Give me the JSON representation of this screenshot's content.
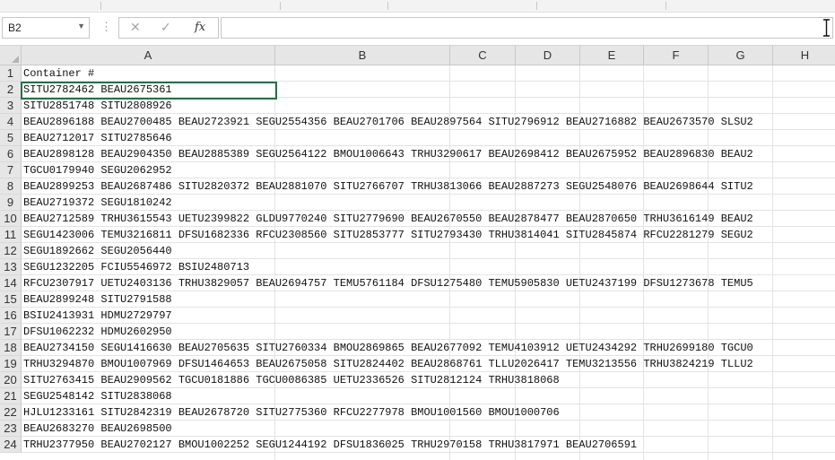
{
  "formula_bar": {
    "name_box": "B2",
    "formula": "",
    "cancel_icon": "cancel-icon",
    "enter_icon": "check-icon",
    "function_label": "fx"
  },
  "columns": [
    "A",
    "B",
    "C",
    "D",
    "E",
    "F",
    "G",
    "H"
  ],
  "rows": [
    {
      "num": "1",
      "text": "Container #"
    },
    {
      "num": "2",
      "text": "SITU2782462 BEAU2675361"
    },
    {
      "num": "3",
      "text": "SITU2851748 SITU2808926"
    },
    {
      "num": "4",
      "text": "BEAU2896188 BEAU2700485 BEAU2723921 SEGU2554356 BEAU2701706 BEAU2897564 SITU2796912 BEAU2716882 BEAU2673570 SLSU2"
    },
    {
      "num": "5",
      "text": "BEAU2712017 SITU2785646"
    },
    {
      "num": "6",
      "text": "BEAU2898128 BEAU2904350 BEAU2885389 SEGU2564122 BMOU1006643 TRHU3290617 BEAU2698412 BEAU2675952 BEAU2896830 BEAU2"
    },
    {
      "num": "7",
      "text": "TGCU0179940 SEGU2062952"
    },
    {
      "num": "8",
      "text": "BEAU2899253 BEAU2687486 SITU2820372 BEAU2881070 SITU2766707 TRHU3813066 BEAU2887273 SEGU2548076 BEAU2698644 SITU2"
    },
    {
      "num": "9",
      "text": "BEAU2719372 SEGU1810242"
    },
    {
      "num": "10",
      "text": "BEAU2712589 TRHU3615543 UETU2399822 GLDU9770240 SITU2779690 BEAU2670550 BEAU2878477 BEAU2870650 TRHU3616149 BEAU2"
    },
    {
      "num": "11",
      "text": "SEGU1423006 TEMU3216811 DFSU1682336 RFCU2308560 SITU2853777 SITU2793430 TRHU3814041 SITU2845874 RFCU2281279 SEGU2"
    },
    {
      "num": "12",
      "text": "SEGU1892662 SEGU2056440"
    },
    {
      "num": "13",
      "text": "SEGU1232205 FCIU5546972 BSIU2480713"
    },
    {
      "num": "14",
      "text": "RFCU2307917 UETU2403136 TRHU3829057 BEAU2694757 TEMU5761184 DFSU1275480 TEMU5905830 UETU2437199 DFSU1273678 TEMU5"
    },
    {
      "num": "15",
      "text": "BEAU2899248 SITU2791588"
    },
    {
      "num": "16",
      "text": "BSIU2413931 HDMU2729797"
    },
    {
      "num": "17",
      "text": "DFSU1062232 HDMU2602950"
    },
    {
      "num": "18",
      "text": "BEAU2734150 SEGU1416630 BEAU2705635 SITU2760334 BMOU2869865 BEAU2677092 TEMU4103912 UETU2434292 TRHU2699180 TGCU0"
    },
    {
      "num": "19",
      "text": "TRHU3294870 BMOU1007969 DFSU1464653 BEAU2675058 SITU2824402 BEAU2868761 TLLU2026417 TEMU3213556 TRHU3824219 TLLU2"
    },
    {
      "num": "20",
      "text": "SITU2763415 BEAU2909562 TGCU0181886 TGCU0086385 UETU2336526 SITU2812124 TRHU3818068"
    },
    {
      "num": "21",
      "text": "SEGU2548142 SITU2838068"
    },
    {
      "num": "22",
      "text": "HJLU1233161 SITU2842319 BEAU2678720 SITU2775360 RFCU2277978 BMOU1001560 BMOU1000706"
    },
    {
      "num": "23",
      "text": "BEAU2683270 BEAU2698500"
    },
    {
      "num": "24",
      "text": "TRHU2377950 BEAU2702127 BMOU1002252 SEGU1244192 DFSU1836025 TRHU2970158 TRHU3817971 BEAU2706591"
    }
  ],
  "colors": {
    "header_bg": "#e6e6e6",
    "grid": "#e3e3e3",
    "selection": "#217346"
  }
}
